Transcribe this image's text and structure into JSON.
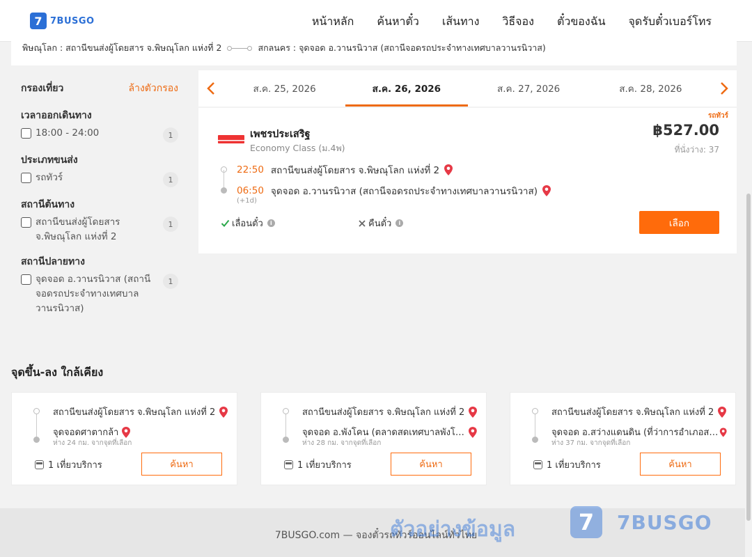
{
  "brand": {
    "logo_glyph": "7",
    "name": "7BUSGO",
    "accent": "#ee6a12",
    "brand_blue": "#2b6fd6"
  },
  "nav": [
    "หน้าหลัก",
    "ค้นหาตั๋ว",
    "เส้นทาง",
    "วิธีจอง",
    "ตั๋วของฉัน",
    "จุดรับตั๋วเบอร์โทร"
  ],
  "route": {
    "from": "พิษณุโลก : สถานีขนส่งผู้โดยสาร จ.พิษณุโลก แห่งที่ 2",
    "to": "สกลนคร : จุดจอด อ.วานรนิวาส (สถานีจอดรถประจำทางเทศบาลวานรนิวาส)"
  },
  "filter": {
    "title": "กรองเที่ยว",
    "clear": "ล้างตัวกรอง",
    "groups": [
      {
        "title": "เวลาออกเดินทาง",
        "option": "18:00 - 24:00",
        "count": "1"
      },
      {
        "title": "ประเภทขนส่ง",
        "option": "รถทัวร์",
        "count": "1"
      },
      {
        "title": "สถานีต้นทาง",
        "option": "สถานีขนส่งผู้โดยสาร จ.พิษณุโลก แห่งที่ 2",
        "count": "1"
      },
      {
        "title": "สถานีปลายทาง",
        "option": "จุดจอด อ.วานรนิวาส (สถานีจอดรถประจำทางเทศบาลวานรนิวาส)",
        "count": "1"
      }
    ]
  },
  "dates": {
    "prev_icon": "‹",
    "next_icon": "›",
    "tabs": [
      "ส.ค. 25, 2026",
      "ส.ค. 26, 2026",
      "ส.ค. 27, 2026",
      "ส.ค. 28, 2026"
    ],
    "active_index": 1
  },
  "result": {
    "tag": "รถทัวร์",
    "operator": "เพชรประเสริฐ",
    "class": "Economy Class (ม.4พ)",
    "price": "฿527.00",
    "seats": "ที่นั่งว่าง: 37",
    "depart_time": "22:50",
    "depart_station": "สถานีขนส่งผู้โดยสาร จ.พิษณุโลก แห่งที่ 2",
    "arrive_time": "06:50",
    "arrive_station": "จุดจอด อ.วานรนิวาส (สถานีจอดรถประจำทางเทศบาลวานรนิวาส)",
    "plus_day": "(+1d)",
    "reschedule": "เลื่อนตั๋ว",
    "refund": "คืนตั๋ว",
    "select": "เลือก"
  },
  "nearby": {
    "title": "จุดขึ้น-ลง ใกล้เคียง",
    "cards": [
      {
        "from": "สถานีขนส่งผู้โดยสาร จ.พิษณุโลก แห่งที่ 2",
        "to": "จุดจอดศาตากล้า",
        "dist": "ห่าง 24 กม. จากจุดที่เลือก",
        "trips": "1 เที่ยวบริการ",
        "button": "ค้นหา"
      },
      {
        "from": "สถานีขนส่งผู้โดยสาร จ.พิษณุโลก แห่งที่ 2",
        "to": "จุดจอด อ.พังโคน (ตลาดสดเทศบาลพังโคน)",
        "dist": "ห่าง 28 กม. จากจุดที่เลือก",
        "trips": "1 เที่ยวบริการ",
        "button": "ค้นหา"
      },
      {
        "from": "สถานีขนส่งผู้โดยสาร จ.พิษณุโลก แห่งที่ 2",
        "to": "จุดจอด อ.สว่างแดนดิน (ที่ว่าการอำเภอสว่างแดนดิน)",
        "dist": "ห่าง 37 กม. จากจุดที่เลือก",
        "trips": "1 เที่ยวบริการ",
        "button": "ค้นหา"
      }
    ]
  },
  "footer": {
    "text": "7BUSGO.com — จองตั๋วรถทัวร์ออนไลน์ทั่วไทย",
    "watermark": "ตัวอย่างข้อมูล",
    "watermark_logo_glyph": "7",
    "watermark_brand": "7BUSGO"
  }
}
